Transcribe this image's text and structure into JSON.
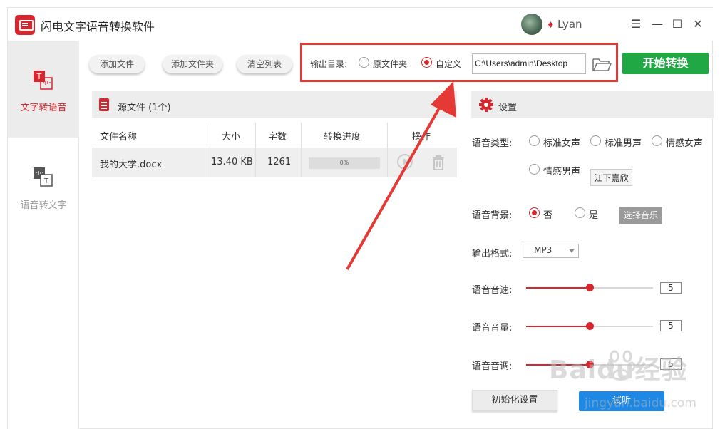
{
  "app": {
    "title": "闪电文字语音转换软件",
    "user": "Lyan"
  },
  "window_controls": {
    "menu": "☰",
    "minimize": "—",
    "maximize": "☐",
    "close": "✕"
  },
  "sidebar": {
    "items": [
      {
        "label": "文字转语音",
        "active": true
      },
      {
        "label": "语音转文字",
        "active": false
      }
    ]
  },
  "toolbar": {
    "add_file": "添加文件",
    "add_folder": "添加文件夹",
    "clear_list": "清空列表"
  },
  "output": {
    "label": "输出目录:",
    "option_source": "原文件夹",
    "option_custom": "自定义",
    "selected": "custom",
    "path": "C:\\Users\\admin\\Desktop"
  },
  "start_button": "开始转换",
  "source": {
    "title": "源文件 (1个)",
    "columns": [
      "文件名称",
      "大小",
      "字数",
      "转换进度",
      "操作"
    ],
    "rows": [
      {
        "name": "我的大学.docx",
        "size": "13.40 KB",
        "chars": "1261",
        "progress": 0,
        "progress_text": "0%"
      }
    ]
  },
  "settings": {
    "title": "设置",
    "voice_type_label": "语音类型:",
    "voice_options": [
      "标准女声",
      "标准男声",
      "情感女声",
      "情感男声"
    ],
    "voice_name_button": "江下嘉欣",
    "background_label": "语音背景:",
    "background_no": "否",
    "background_yes": "是",
    "background_selected": "no",
    "choose_music": "选择音乐",
    "format_label": "输出格式:",
    "format_value": "MP3",
    "speed_label": "语音音速:",
    "speed_value": "5",
    "volume_label": "语音音量:",
    "volume_value": "5",
    "pitch_label": "语音音调:",
    "pitch_value": "5",
    "slider_max": 10,
    "reset_button": "初始化设置",
    "listen_button": "试听"
  },
  "watermark": {
    "brand": "Baidu经验",
    "url": "jingyan.baidu.com"
  },
  "colors": {
    "brand_red": "#d8262e",
    "start_green": "#20a845",
    "annotation_red": "#e53935",
    "listen_blue": "#1e88e5"
  }
}
